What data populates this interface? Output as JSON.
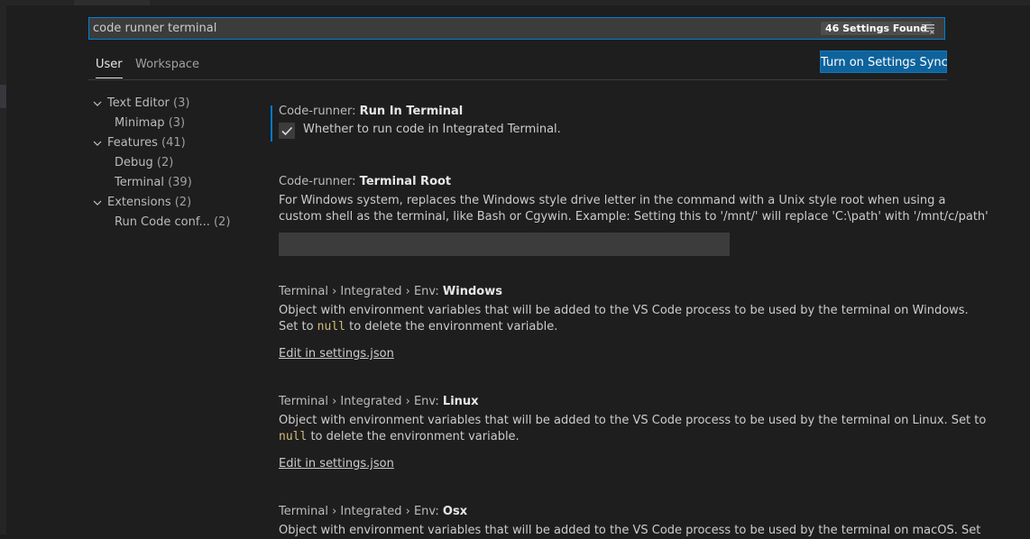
{
  "search": {
    "value": "code runner terminal",
    "results_count": "46 Settings Found",
    "filter_icon": "clear-filter-icon"
  },
  "tabs": [
    {
      "label": "User",
      "active": true
    },
    {
      "label": "Workspace",
      "active": false
    }
  ],
  "sync_button_label": "Turn on Settings Sync",
  "tree": [
    {
      "label": "Text Editor",
      "count": "(3)",
      "expanded": true
    },
    {
      "label": "Minimap",
      "count": "(3)"
    },
    {
      "label": "Features",
      "count": "(41)",
      "expanded": true
    },
    {
      "label": "Debug",
      "count": "(2)"
    },
    {
      "label": "Terminal",
      "count": "(39)"
    },
    {
      "label": "Extensions",
      "count": "(2)",
      "expanded": true
    },
    {
      "label": "Run Code conf...",
      "count": "(2)"
    }
  ],
  "settings": {
    "run_in_terminal": {
      "category": "Code-runner: ",
      "name": "Run In Terminal",
      "checkbox_label": "Whether to run code in Integrated Terminal.",
      "checked": true
    },
    "terminal_root": {
      "category": "Code-runner: ",
      "name": "Terminal Root",
      "desc_line1": "For Windows system, replaces the Windows style drive letter in the command with a Unix style root when using a",
      "desc_line2": "custom shell as the terminal, like Bash or Cgywin. Example: Setting this to '/mnt/' will replace 'C:\\path' with '/mnt/c/path'",
      "value": ""
    },
    "env_windows": {
      "category": "Terminal › Integrated › Env: ",
      "name": "Windows",
      "desc_line1": "Object with environment variables that will be added to the VS Code process to be used by the terminal on Windows.",
      "desc_pre": "Set to ",
      "desc_code": "null",
      "desc_post": " to delete the environment variable.",
      "link": "Edit in settings.json"
    },
    "env_linux": {
      "category": "Terminal › Integrated › Env: ",
      "name": "Linux",
      "desc_line1": "Object with environment variables that will be added to the VS Code process to be used by the terminal on Linux. Set to",
      "desc_code": "null",
      "desc_post": " to delete the environment variable.",
      "link": "Edit in settings.json"
    },
    "env_osx": {
      "category": "Terminal › Integrated › Env: ",
      "name": "Osx",
      "desc_line1": "Object with environment variables that will be added to the VS Code process to be used by the terminal on macOS. Set"
    }
  },
  "colors": {
    "accent": "#007fd4",
    "button": "#0e639c",
    "background": "#1e1e1e"
  }
}
